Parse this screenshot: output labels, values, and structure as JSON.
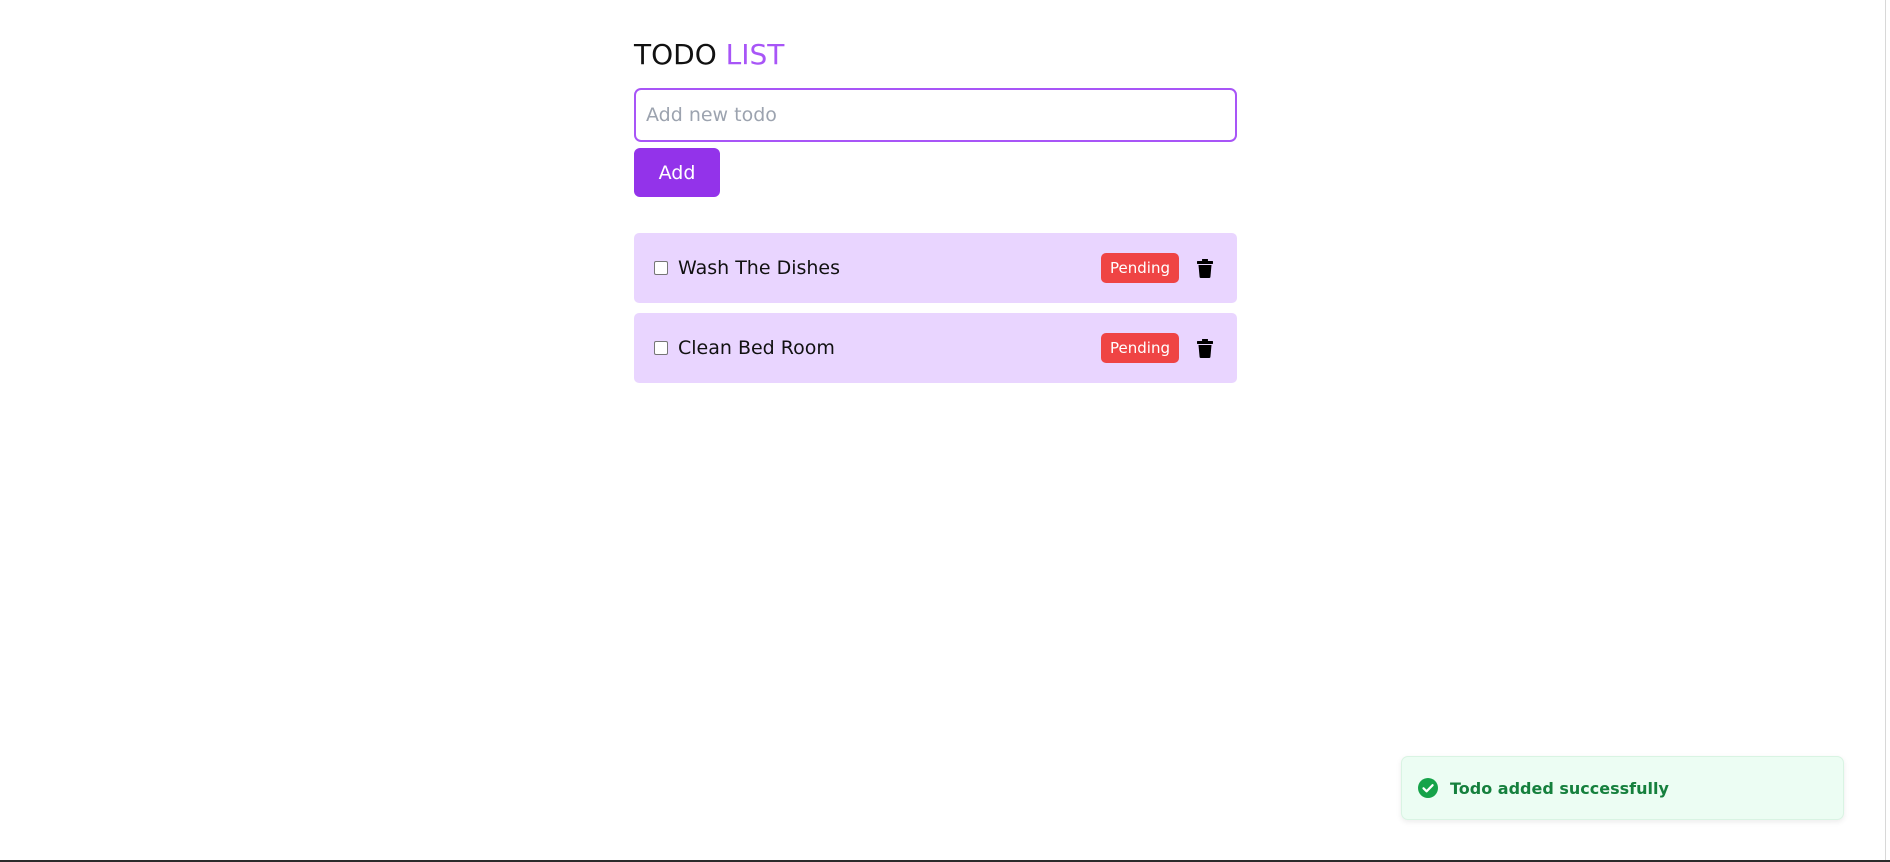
{
  "header": {
    "title_part1": "TODO",
    "title_part2": "LIST"
  },
  "new_todo": {
    "placeholder": "Add new todo",
    "value": "",
    "add_label": "Add"
  },
  "todos": [
    {
      "label": "Wash The Dishes",
      "status": "Pending",
      "checked": false,
      "delete_icon": "trash-icon"
    },
    {
      "label": "Clean Bed Room",
      "status": "Pending",
      "checked": false,
      "delete_icon": "trash-icon"
    }
  ],
  "toast": {
    "message": "Todo added successfully",
    "icon": "check-circle-icon",
    "type": "success"
  },
  "colors": {
    "accent": "#a855f7",
    "button": "#9333ea",
    "item_background": "#e9d5ff",
    "pending_badge": "#ef4444",
    "toast_background": "#ecfdf3",
    "toast_text": "#15803d",
    "toast_icon": "#16a34a"
  }
}
